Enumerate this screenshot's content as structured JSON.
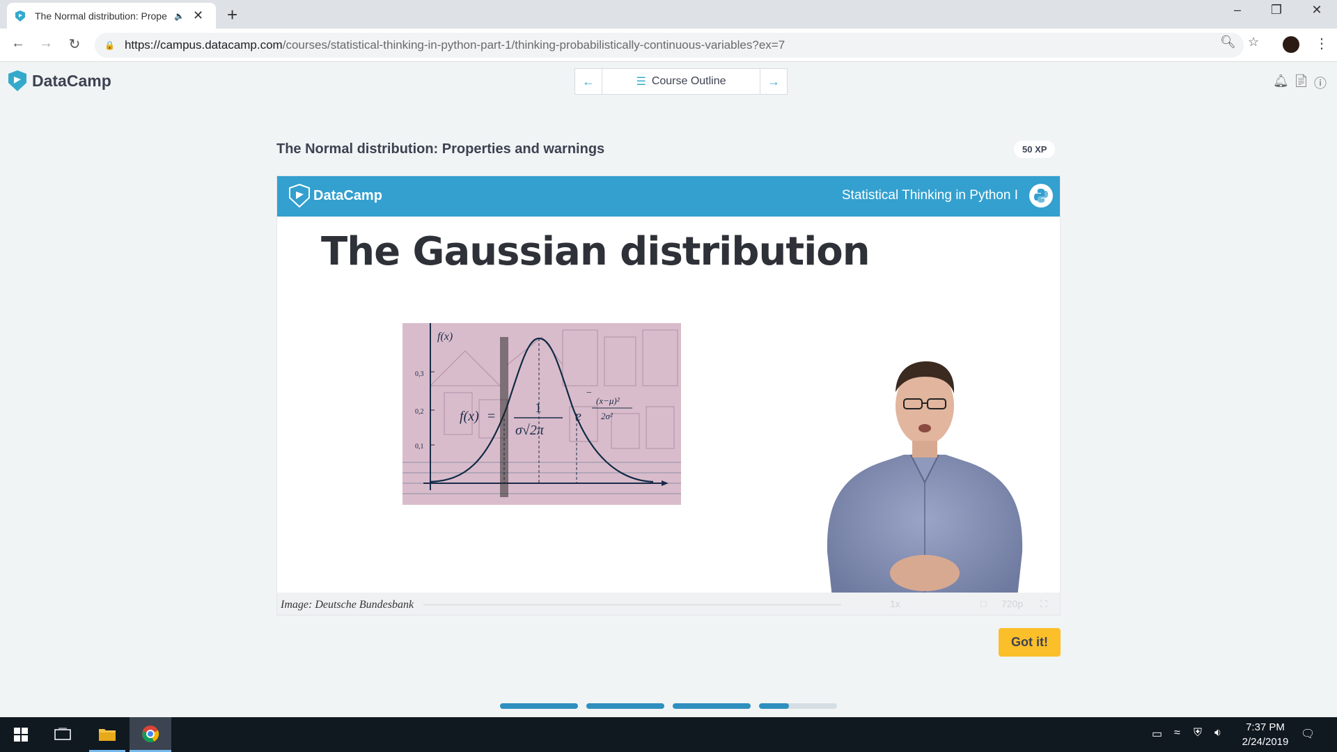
{
  "browser": {
    "tab_title": "The Normal distribution: Properties and warnings",
    "url_host": "https://campus.datacamp.com",
    "url_path": "/courses/statistical-thinking-in-python-part-1/thinking-probabilistically-continuous-variables?ex=7"
  },
  "header": {
    "logo_text": "DataCamp",
    "course_outline_label": "Course Outline"
  },
  "exercise": {
    "title": "The Normal distribution: Properties and warnings",
    "xp": "50 XP"
  },
  "video": {
    "brand": "DataCamp",
    "course_name": "Statistical Thinking in Python I",
    "slide_title": "The Gaussian distribution",
    "caption": "Image: Deutsche Bundesbank",
    "speed": "1x",
    "quality": "720p"
  },
  "actions": {
    "got_it_label": "Got it!"
  },
  "progress": [
    1.0,
    1.0,
    1.0,
    0.38
  ],
  "taskbar": {
    "time": "7:37 PM",
    "date": "2/24/2019"
  },
  "colors": {
    "brand_blue": "#33a0cf",
    "got_it": "#fbbf2a",
    "progress_fill": "#2f8fbf"
  }
}
